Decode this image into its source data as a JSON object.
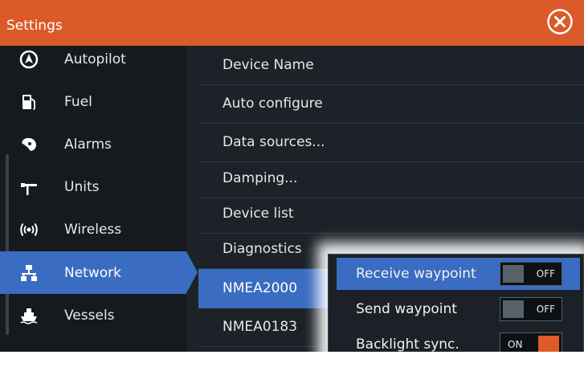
{
  "window": {
    "title": "Settings"
  },
  "sidebar": {
    "items": [
      {
        "label": "Autopilot",
        "icon": "autopilot-icon",
        "selected": false
      },
      {
        "label": "Fuel",
        "icon": "fuel-pump-icon",
        "selected": false
      },
      {
        "label": "Alarms",
        "icon": "alarm-bell-icon",
        "selected": false
      },
      {
        "label": "Units",
        "icon": "units-ruler-icon",
        "selected": false
      },
      {
        "label": "Wireless",
        "icon": "wireless-icon",
        "selected": false
      },
      {
        "label": "Network",
        "icon": "network-icon",
        "selected": true
      },
      {
        "label": "Vessels",
        "icon": "vessels-icon",
        "selected": false
      }
    ]
  },
  "network_list": {
    "items": [
      {
        "label": "Device Name"
      },
      {
        "label": "Auto configure"
      },
      {
        "label": "Data sources..."
      },
      {
        "label": "Damping..."
      },
      {
        "label": "Device list"
      },
      {
        "label": "Diagnostics"
      },
      {
        "label": "NMEA2000",
        "selected": true
      },
      {
        "label": "NMEA0183"
      }
    ]
  },
  "popup": {
    "rows": [
      {
        "label": "Receive waypoint",
        "state": "OFF",
        "selected": true
      },
      {
        "label": "Send waypoint",
        "state": "OFF",
        "selected": false
      },
      {
        "label": "Backlight sync.",
        "state": "ON",
        "selected": false
      }
    ]
  },
  "colors": {
    "accent_orange": "#dc5a2a",
    "selection_blue": "#3a6cc1",
    "panel_dark": "#1c2228",
    "toggle_on": "#e05a28"
  }
}
